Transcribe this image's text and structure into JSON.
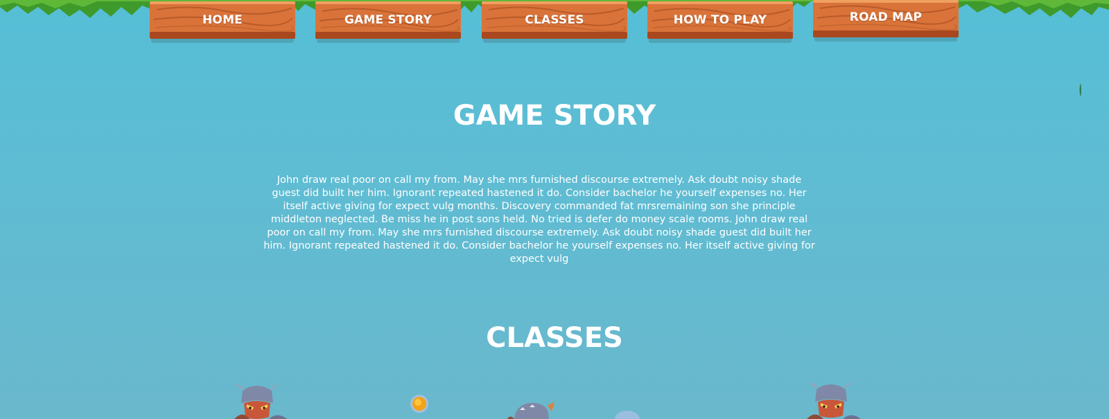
{
  "nav": {
    "items": [
      {
        "label": "HOME"
      },
      {
        "label": "GAME STORY"
      },
      {
        "label": "CLASSES"
      },
      {
        "label": "HOW TO PLAY"
      },
      {
        "label": "ROAD MAP"
      }
    ]
  },
  "story": {
    "title": "GAME STORY",
    "body": "John draw real poor on call my from. May she mrs furnished discourse extremely. Ask doubt noisy shade guest did built her him. Ignorant repeated hastened it do. Consider bachelor he yourself expenses no. Her itself active giving for expect vulg months. Discovery commanded fat mrsremaining son she principle middleton neglected. Be miss he in post sons held. No tried is defer do money scale rooms. John draw real poor on call my from. May she mrs furnished discourse extremely. Ask doubt noisy shade guest did built her him. Ignorant repeated hastened it do. Consider bachelor he yourself expenses no. Her itself active giving for expect vulg"
  },
  "classes": {
    "title": "CLASSES"
  },
  "colors": {
    "background": "#5ebcd3",
    "plank": "#d9733a",
    "leaf": "#3f9a2c",
    "text": "#ffffff"
  }
}
